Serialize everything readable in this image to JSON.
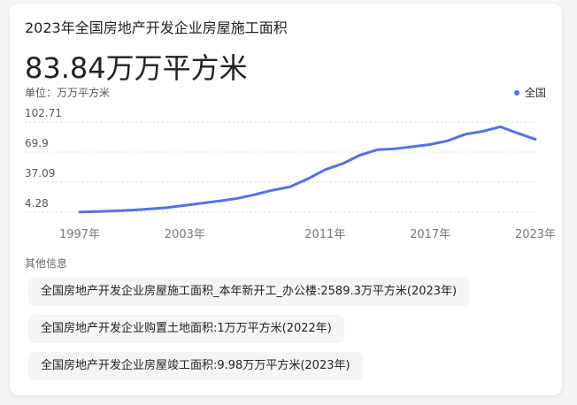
{
  "header": {
    "title": "2023年全国房地产开发企业房屋施工面积",
    "value": "83.84万万平方米",
    "unit_label": "单位：万万平方米",
    "legend_label": "全国"
  },
  "colors": {
    "series": "#5570e8",
    "grid": "#dddddd"
  },
  "chart_data": {
    "type": "line",
    "xlabel": "",
    "ylabel": "",
    "ytick_labels": [
      "102.71",
      "69.9",
      "37.09",
      "4.28"
    ],
    "ytick_values": [
      102.71,
      69.9,
      37.09,
      4.28
    ],
    "xtick_labels": [
      "1997年",
      "2003年",
      "2011年",
      "2017年",
      "2023年"
    ],
    "xtick_years": [
      1997,
      2003,
      2011,
      2017,
      2023
    ],
    "ylim": [
      4.28,
      102.71
    ],
    "xlim": [
      1997,
      2023
    ],
    "grid": "horizontal dashed",
    "legend": "top-right",
    "series": [
      {
        "name": "全国",
        "x": [
          1997,
          1998,
          1999,
          2000,
          2001,
          2002,
          2003,
          2004,
          2005,
          2006,
          2007,
          2008,
          2009,
          2010,
          2011,
          2012,
          2013,
          2014,
          2015,
          2016,
          2017,
          2018,
          2019,
          2020,
          2021,
          2022,
          2023
        ],
        "values": [
          4.5,
          5.1,
          5.7,
          6.6,
          7.9,
          9.4,
          11.7,
          14.1,
          16.6,
          19.4,
          23.6,
          28.3,
          32.0,
          40.6,
          50.7,
          57.3,
          66.6,
          72.6,
          73.6,
          75.8,
          78.2,
          82.3,
          89.4,
          92.6,
          97.5,
          90.5,
          83.84
        ]
      }
    ]
  },
  "other_info": {
    "title": "其他信息",
    "items": [
      "全国房地产开发企业房屋施工面积_本年新开工_办公楼:2589.3万平方米(2023年)",
      "全国房地产开发企业购置土地面积:1万万平方米(2022年)",
      "全国房地产开发企业房屋竣工面积:9.98万万平方米(2023年)"
    ]
  }
}
